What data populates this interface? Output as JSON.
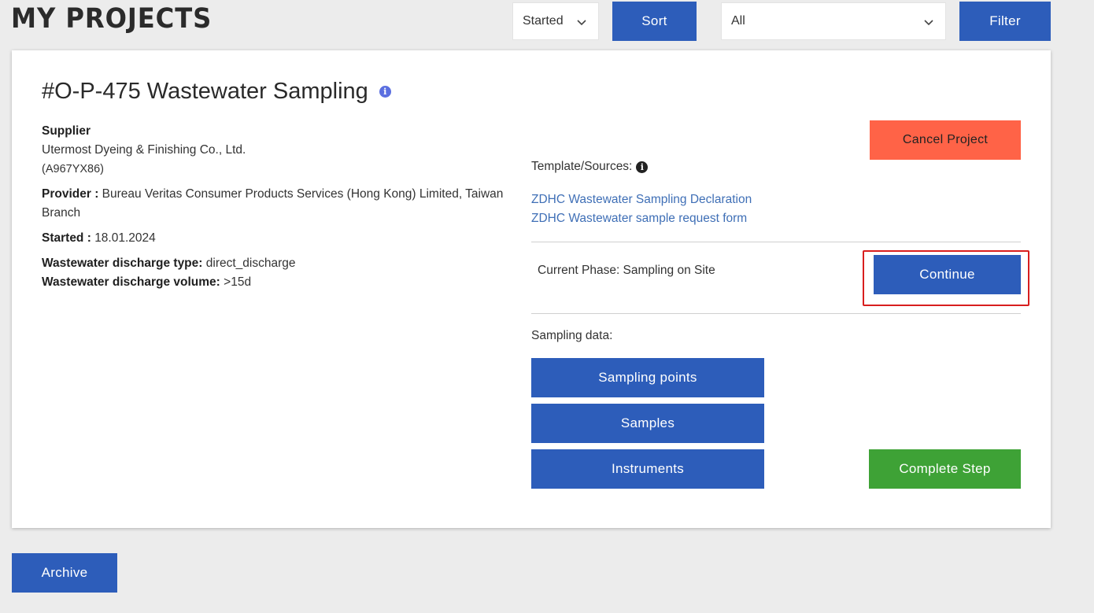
{
  "header": {
    "title": "MY PROJECTS",
    "status_select": "Started",
    "sort_label": "Sort",
    "type_select": "All",
    "filter_label": "Filter"
  },
  "project": {
    "title": "#O-P-475 Wastewater Sampling",
    "supplier_label": "Supplier",
    "supplier_name": "Utermost Dyeing & Finishing Co., Ltd.",
    "supplier_id": "(A967YX86)",
    "provider_label": "Provider :",
    "provider_value": "Bureau Veritas Consumer Products Services (Hong Kong) Limited, Taiwan Branch",
    "started_label": "Started :",
    "started_value": "18.01.2024",
    "discharge_type_label": "Wastewater discharge type:",
    "discharge_type_value": "direct_discharge",
    "discharge_volume_label": "Wastewater discharge volume:",
    "discharge_volume_value": ">15d",
    "cancel_label": "Cancel Project",
    "template_label": "Template/Sources:",
    "links": [
      "ZDHC Wastewater Sampling Declaration",
      "ZDHC Wastewater sample request form"
    ],
    "current_phase": "Current Phase: Sampling on Site",
    "continue_label": "Continue",
    "sampling_label": "Sampling data:",
    "sampling_points_label": "Sampling points",
    "samples_label": "Samples",
    "instruments_label": "Instruments",
    "complete_label": "Complete Step"
  },
  "footer": {
    "archive_label": "Archive"
  },
  "colors": {
    "primary": "#2d5dba",
    "danger": "#ff6347",
    "success": "#3ea236",
    "highlight": "#d81e1e",
    "link": "#3f6fb6"
  }
}
